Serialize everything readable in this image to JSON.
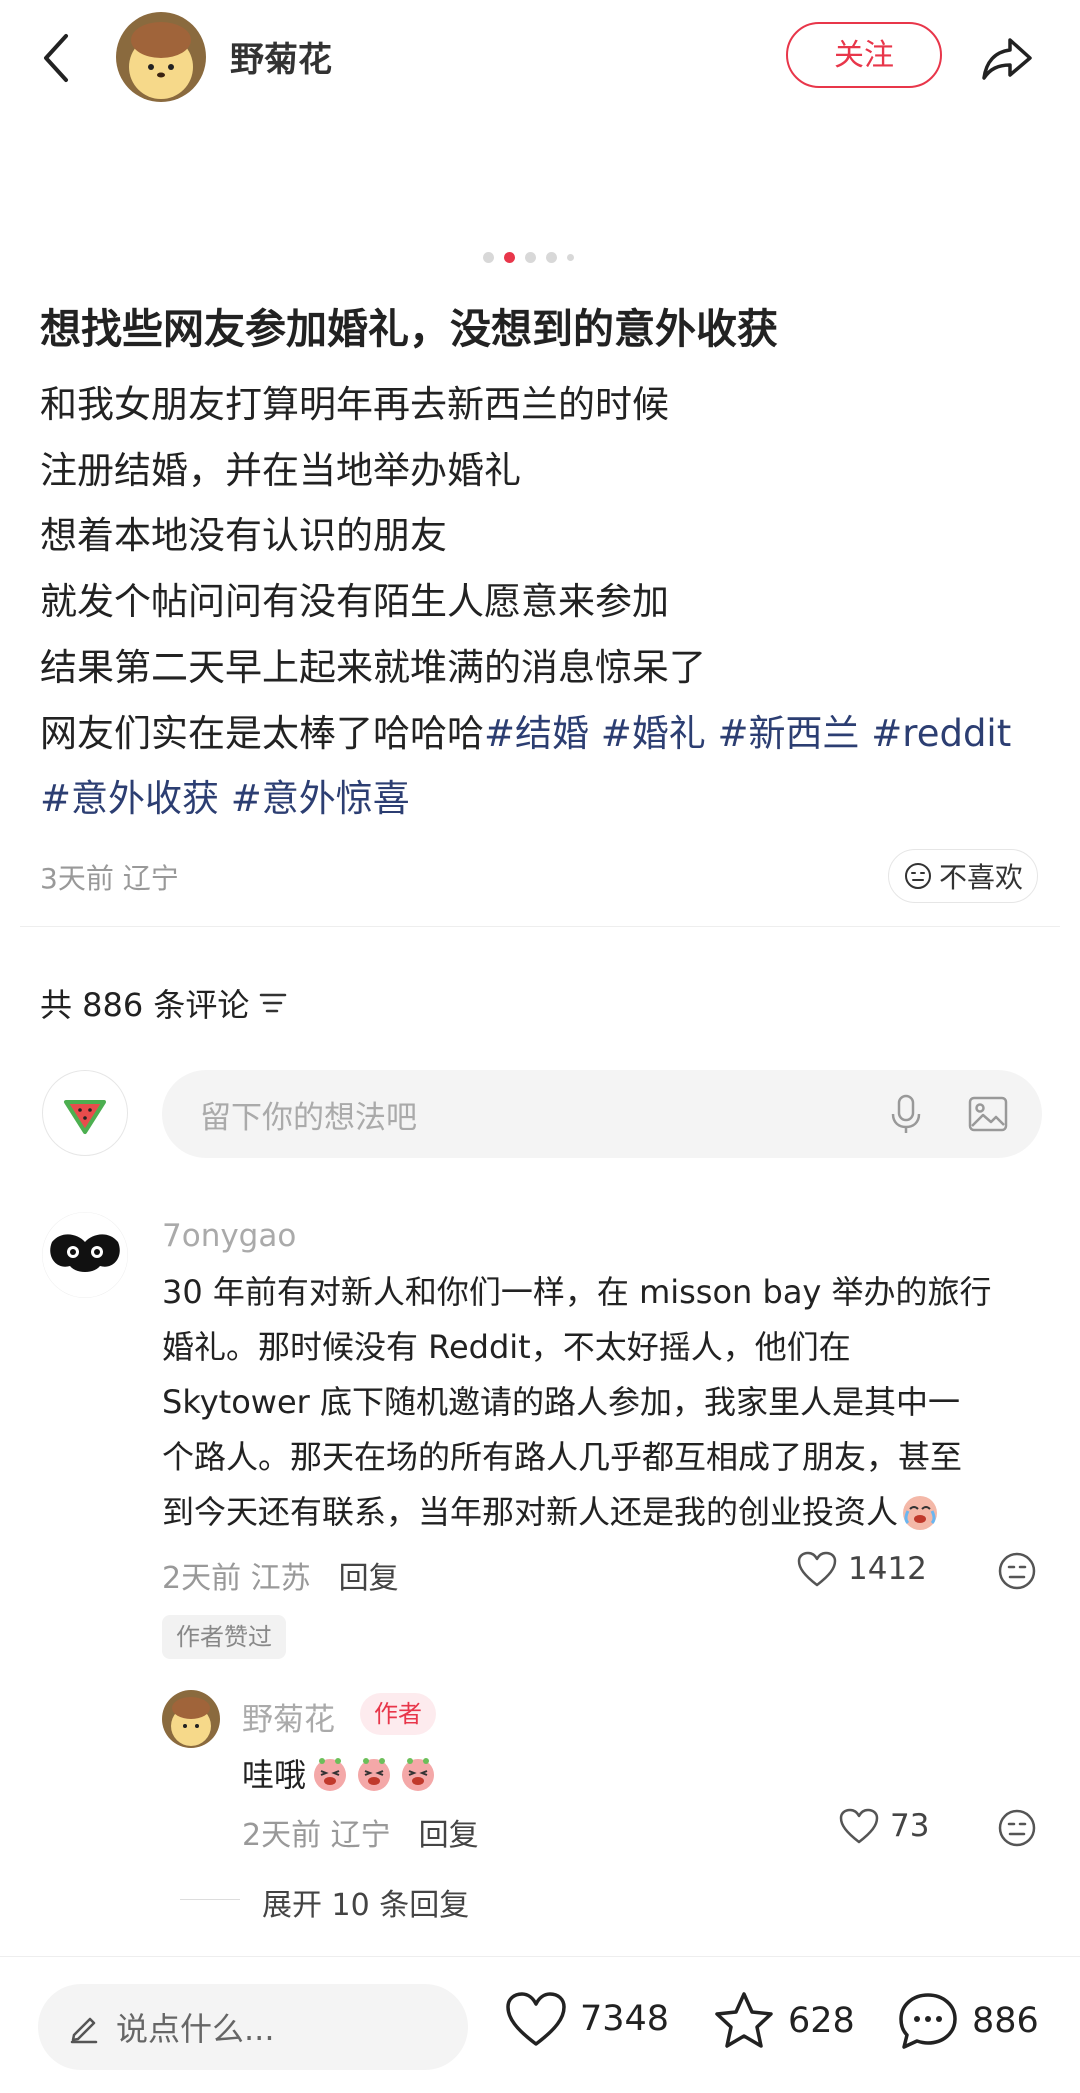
{
  "header": {
    "author_name": "野菊花",
    "follow_label": "关注"
  },
  "carousel": {
    "total": 5,
    "active": 2
  },
  "post": {
    "title": "想找些网友参加婚礼，没想到的意外收获",
    "lines": [
      "和我女朋友打算明年再去新西兰的时候",
      "注册结婚，并在当地举办婚礼",
      "想着本地没有认识的朋友",
      "就发个帖问问有没有陌生人愿意来参加",
      "结果第二天早上起来就堆满的消息惊呆了",
      "网友们实在是太棒了哈哈哈"
    ],
    "tags_line1": "#结婚 #婚礼 #新西兰 #reddit",
    "tags_line2": "#意外收获 #意外惊喜",
    "time": "3天前",
    "location": "辽宁",
    "dislike_label": "不喜欢"
  },
  "comments_header": {
    "label": "共 886 条评论"
  },
  "comment_input": {
    "placeholder": "留下你的想法吧"
  },
  "comment1": {
    "username": "7onygao",
    "lines": [
      "30 年前有对新人和你们一样，在 misson bay 举办的旅行",
      "婚礼。那时候没有 Reddit，不太好摇人，他们在",
      " Skytower 底下随机邀请的路人参加，我家里人是其中一",
      "个路人。那天在场的所有路人几乎都互相成了朋友，甚至",
      "到今天还有联系，当年那对新人还是我的创业投资人"
    ],
    "time": "2天前",
    "location": "江苏",
    "reply_label": "回复",
    "likes": "1412",
    "author_liked": "作者赞过"
  },
  "reply1": {
    "username": "野菊花",
    "badge": "作者",
    "text": "哇哦",
    "time": "2天前",
    "location": "辽宁",
    "reply_label": "回复",
    "likes": "73"
  },
  "expand_replies": "展开 10 条回复",
  "bottom_bar": {
    "input_placeholder": "说点什么...",
    "likes": "7348",
    "collects": "628",
    "comments": "886"
  },
  "colors": {
    "accent": "#e8364a",
    "tag": "#2c3e72"
  }
}
